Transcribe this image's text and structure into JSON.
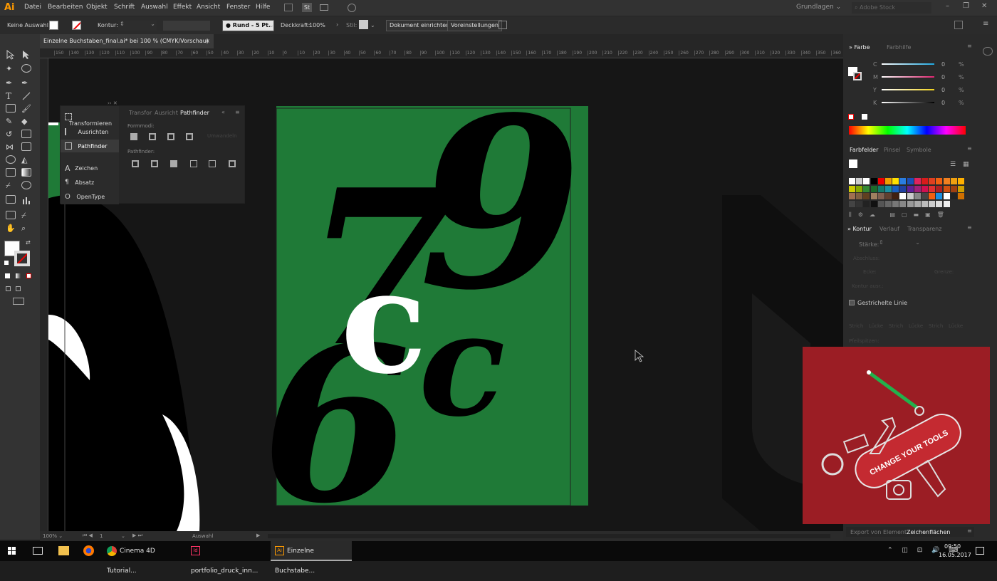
{
  "app": {
    "logo": "Ai",
    "workspace": "Grundlagen",
    "stock_search_placeholder": "Adobe Stock durchsuchen",
    "bridge_label": "St"
  },
  "menu": {
    "items": [
      "Datei",
      "Bearbeiten",
      "Objekt",
      "Schrift",
      "Auswahl",
      "Effekt",
      "Ansicht",
      "Fenster",
      "Hilfe"
    ]
  },
  "control_bar": {
    "selection": "Keine Auswahl",
    "stroke_label": "Kontur:",
    "brush": "Rund - 5 Pt.",
    "opacity_label": "Deckkraft:",
    "opacity_value": "100%",
    "style_label": "Stil:",
    "doc_setup": "Dokument einrichten",
    "preferences": "Voreinstellungen"
  },
  "document_tab": {
    "title": "Einzelne Buchstaben_final.ai* bei 100 % (CMYK/Vorschau)",
    "close": "×"
  },
  "ruler_labels": [
    "150",
    "140",
    "130",
    "120",
    "110",
    "100",
    "90",
    "80",
    "70",
    "60",
    "50",
    "40",
    "30",
    "20",
    "10",
    "0",
    "10",
    "20",
    "30",
    "40",
    "50",
    "60",
    "70",
    "80",
    "90",
    "100",
    "110",
    "120",
    "130",
    "140",
    "150",
    "160",
    "170",
    "180",
    "190",
    "200",
    "210",
    "220",
    "230",
    "240",
    "250",
    "260",
    "270",
    "280",
    "290",
    "300",
    "310",
    "320",
    "330",
    "340",
    "350",
    "360",
    "370"
  ],
  "character_panel": {
    "items": [
      "Transformieren",
      "Ausrichten",
      "Pathfinder",
      "Zeichen",
      "Absatz",
      "OpenType"
    ]
  },
  "pathfinder": {
    "tabs": [
      "Transfor",
      "Ausricht",
      "Pathfinder"
    ],
    "form_modes_label": "Formmodi:",
    "pathfinder_label": "Pathfinder:",
    "expand_label": "Umwandeln"
  },
  "artwork": {
    "digit_nine": "9",
    "digit_seven": "7",
    "letter_c": "c",
    "letter_c2": "c",
    "digit_six": "6"
  },
  "status": {
    "zoom": "100%",
    "artboard": "1",
    "tool": "Auswahl"
  },
  "farbe_panel": {
    "tabs": [
      "Farbe",
      "Farbhilfe"
    ],
    "channels": [
      {
        "label": "C",
        "value": "0",
        "unit": "%"
      },
      {
        "label": "M",
        "value": "0",
        "unit": "%"
      },
      {
        "label": "Y",
        "value": "0",
        "unit": "%"
      },
      {
        "label": "K",
        "value": "0",
        "unit": "%"
      }
    ],
    "colors": {
      "c": "#1fa8e0",
      "m": "#e0236f",
      "y": "#f0d21e",
      "k": "#888888"
    }
  },
  "swatches_panel": {
    "tabs": [
      "Farbfelder",
      "Pinsel",
      "Symbole"
    ]
  },
  "kontur_panel": {
    "tabs": [
      "Kontur",
      "Verlauf",
      "Transparenz"
    ],
    "weight_label": "Stärke:",
    "ends_label": "Abschluss:",
    "corner_label": "Ecke:",
    "limit_label": "Grenze:",
    "align_label": "Kontur ausr.:",
    "dashed_label": "Gestrichelte Linie",
    "dash_fields": [
      "Strich",
      "Lücke",
      "Strich",
      "Lücke",
      "Strich",
      "Lücke"
    ],
    "arrowheads_label": "Pfeilspitzen:"
  },
  "bottom_tabs": [
    "Export von Element",
    "Zeichenflächen"
  ],
  "promo": {
    "text": "CHANGE YOUR TOOLS",
    "colors": {
      "bg": "#9b1d24",
      "knife": "#c42a31",
      "pen": "#22b14c"
    }
  },
  "taskbar": {
    "tasks": [
      "Cinema 4D Tutorial...",
      "portfolio_druck_inn...",
      "Einzelne Buchstabe..."
    ],
    "time": "09:50",
    "date": "16.05.2017"
  }
}
